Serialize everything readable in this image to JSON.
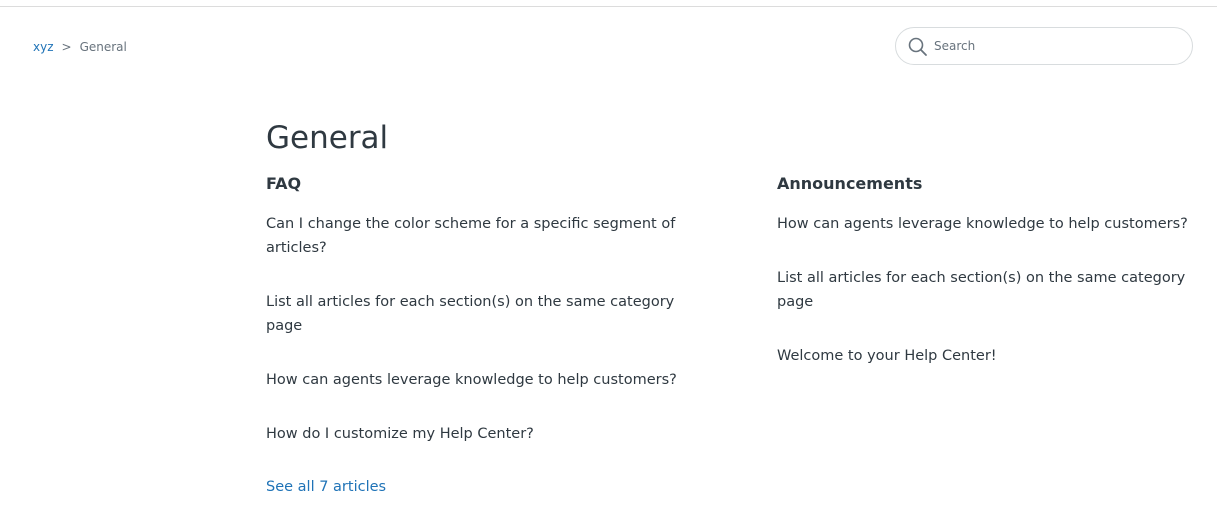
{
  "breadcrumb": {
    "root": "xyz",
    "separator": ">",
    "current": "General"
  },
  "search": {
    "placeholder": "Search",
    "icon": "search-icon"
  },
  "page": {
    "title": "General"
  },
  "sections": [
    {
      "title": "FAQ",
      "articles": [
        "Can I change the color scheme for a specific segment of articles?",
        "List all articles for each section(s) on the same category page",
        "How can agents leverage knowledge to help customers?",
        "How do I customize my Help Center?"
      ],
      "see_all": "See all 7 articles"
    },
    {
      "title": "Announcements",
      "articles": [
        "How can agents leverage knowledge to help customers?",
        "List all articles for each section(s) on the same category page",
        "Welcome to your Help Center!"
      ]
    }
  ],
  "colors": {
    "link": "#1f73b7",
    "text": "#2f3941",
    "muted": "#68737d",
    "border": "#d8dcde"
  }
}
